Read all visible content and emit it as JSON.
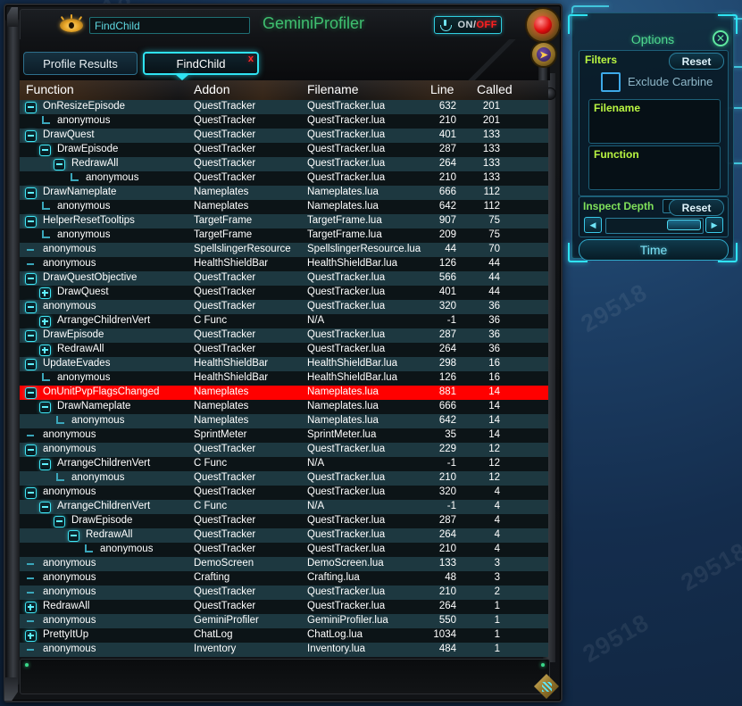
{
  "window": {
    "app_title": "GeminiProfiler",
    "name_field_value": "FindChild",
    "toggle": {
      "on_label": "ON",
      "separator": "/",
      "off_label": "OFF"
    },
    "logo_icon": "eye-icon"
  },
  "tabs": [
    {
      "label": "Profile Results",
      "active": false
    },
    {
      "label": "FindChild",
      "active": true,
      "close_icon": "x"
    }
  ],
  "table": {
    "columns": [
      "Function",
      "Addon",
      "Filename",
      "Line",
      "Called"
    ],
    "rows": [
      {
        "indent": 0,
        "node": "minus",
        "function": "OnResizeEpisode",
        "addon": "QuestTracker",
        "filename": "QuestTracker.lua",
        "line": "632",
        "called": "201",
        "selected": false
      },
      {
        "indent": 1,
        "node": "elbow",
        "function": "anonymous",
        "addon": "QuestTracker",
        "filename": "QuestTracker.lua",
        "line": "210",
        "called": "201",
        "selected": false
      },
      {
        "indent": 0,
        "node": "minus",
        "function": "DrawQuest",
        "addon": "QuestTracker",
        "filename": "QuestTracker.lua",
        "line": "401",
        "called": "133",
        "selected": false
      },
      {
        "indent": 1,
        "node": "minus",
        "function": "DrawEpisode",
        "addon": "QuestTracker",
        "filename": "QuestTracker.lua",
        "line": "287",
        "called": "133",
        "selected": false
      },
      {
        "indent": 2,
        "node": "minus",
        "function": "RedrawAll",
        "addon": "QuestTracker",
        "filename": "QuestTracker.lua",
        "line": "264",
        "called": "133",
        "selected": false
      },
      {
        "indent": 3,
        "node": "elbow",
        "function": "anonymous",
        "addon": "QuestTracker",
        "filename": "QuestTracker.lua",
        "line": "210",
        "called": "133",
        "selected": false
      },
      {
        "indent": 0,
        "node": "minus",
        "function": "DrawNameplate",
        "addon": "Nameplates",
        "filename": "Nameplates.lua",
        "line": "666",
        "called": "112",
        "selected": false
      },
      {
        "indent": 1,
        "node": "elbow",
        "function": "anonymous",
        "addon": "Nameplates",
        "filename": "Nameplates.lua",
        "line": "642",
        "called": "112",
        "selected": false
      },
      {
        "indent": 0,
        "node": "minus",
        "function": "HelperResetTooltips",
        "addon": "TargetFrame",
        "filename": "TargetFrame.lua",
        "line": "907",
        "called": "75",
        "selected": false
      },
      {
        "indent": 1,
        "node": "elbow",
        "function": "anonymous",
        "addon": "TargetFrame",
        "filename": "TargetFrame.lua",
        "line": "209",
        "called": "75",
        "selected": false
      },
      {
        "indent": 0,
        "node": "leaf",
        "function": "anonymous",
        "addon": "SpellslingerResource",
        "filename": "SpellslingerResource.lua",
        "line": "44",
        "called": "70",
        "selected": false
      },
      {
        "indent": 0,
        "node": "leaf",
        "function": "anonymous",
        "addon": "HealthShieldBar",
        "filename": "HealthShieldBar.lua",
        "line": "126",
        "called": "44",
        "selected": false
      },
      {
        "indent": 0,
        "node": "minus",
        "function": "DrawQuestObjective",
        "addon": "QuestTracker",
        "filename": "QuestTracker.lua",
        "line": "566",
        "called": "44",
        "selected": false
      },
      {
        "indent": 1,
        "node": "plus",
        "function": "DrawQuest",
        "addon": "QuestTracker",
        "filename": "QuestTracker.lua",
        "line": "401",
        "called": "44",
        "selected": false
      },
      {
        "indent": 0,
        "node": "minus",
        "function": "anonymous",
        "addon": "QuestTracker",
        "filename": "QuestTracker.lua",
        "line": "320",
        "called": "36",
        "selected": false
      },
      {
        "indent": 1,
        "node": "plus",
        "function": "ArrangeChildrenVert",
        "addon": "C Func",
        "filename": "N/A",
        "line": "-1",
        "called": "36",
        "selected": false
      },
      {
        "indent": 0,
        "node": "minus",
        "function": "DrawEpisode",
        "addon": "QuestTracker",
        "filename": "QuestTracker.lua",
        "line": "287",
        "called": "36",
        "selected": false
      },
      {
        "indent": 1,
        "node": "plus",
        "function": "RedrawAll",
        "addon": "QuestTracker",
        "filename": "QuestTracker.lua",
        "line": "264",
        "called": "36",
        "selected": false
      },
      {
        "indent": 0,
        "node": "minus",
        "function": "UpdateEvades",
        "addon": "HealthShieldBar",
        "filename": "HealthShieldBar.lua",
        "line": "298",
        "called": "16",
        "selected": false
      },
      {
        "indent": 1,
        "node": "elbow",
        "function": "anonymous",
        "addon": "HealthShieldBar",
        "filename": "HealthShieldBar.lua",
        "line": "126",
        "called": "16",
        "selected": false
      },
      {
        "indent": 0,
        "node": "minus",
        "function": "OnUnitPvpFlagsChanged",
        "addon": "Nameplates",
        "filename": "Nameplates.lua",
        "line": "881",
        "called": "14",
        "selected": true
      },
      {
        "indent": 1,
        "node": "minus",
        "function": "DrawNameplate",
        "addon": "Nameplates",
        "filename": "Nameplates.lua",
        "line": "666",
        "called": "14",
        "selected": false
      },
      {
        "indent": 2,
        "node": "elbow",
        "function": "anonymous",
        "addon": "Nameplates",
        "filename": "Nameplates.lua",
        "line": "642",
        "called": "14",
        "selected": false
      },
      {
        "indent": 0,
        "node": "leaf",
        "function": "anonymous",
        "addon": "SprintMeter",
        "filename": "SprintMeter.lua",
        "line": "35",
        "called": "14",
        "selected": false
      },
      {
        "indent": 0,
        "node": "minus",
        "function": "anonymous",
        "addon": "QuestTracker",
        "filename": "QuestTracker.lua",
        "line": "229",
        "called": "12",
        "selected": false
      },
      {
        "indent": 1,
        "node": "minus",
        "function": "ArrangeChildrenVert",
        "addon": "C Func",
        "filename": "N/A",
        "line": "-1",
        "called": "12",
        "selected": false
      },
      {
        "indent": 2,
        "node": "elbow",
        "function": "anonymous",
        "addon": "QuestTracker",
        "filename": "QuestTracker.lua",
        "line": "210",
        "called": "12",
        "selected": false
      },
      {
        "indent": 0,
        "node": "minus",
        "function": "anonymous",
        "addon": "QuestTracker",
        "filename": "QuestTracker.lua",
        "line": "320",
        "called": "4",
        "selected": false
      },
      {
        "indent": 1,
        "node": "minus",
        "function": "ArrangeChildrenVert",
        "addon": "C Func",
        "filename": "N/A",
        "line": "-1",
        "called": "4",
        "selected": false
      },
      {
        "indent": 2,
        "node": "minus",
        "function": "DrawEpisode",
        "addon": "QuestTracker",
        "filename": "QuestTracker.lua",
        "line": "287",
        "called": "4",
        "selected": false
      },
      {
        "indent": 3,
        "node": "minus",
        "function": "RedrawAll",
        "addon": "QuestTracker",
        "filename": "QuestTracker.lua",
        "line": "264",
        "called": "4",
        "selected": false
      },
      {
        "indent": 4,
        "node": "elbow",
        "function": "anonymous",
        "addon": "QuestTracker",
        "filename": "QuestTracker.lua",
        "line": "210",
        "called": "4",
        "selected": false
      },
      {
        "indent": 0,
        "node": "leaf",
        "function": "anonymous",
        "addon": "DemoScreen",
        "filename": "DemoScreen.lua",
        "line": "133",
        "called": "3",
        "selected": false
      },
      {
        "indent": 0,
        "node": "leaf",
        "function": "anonymous",
        "addon": "Crafting",
        "filename": "Crafting.lua",
        "line": "48",
        "called": "3",
        "selected": false
      },
      {
        "indent": 0,
        "node": "leaf",
        "function": "anonymous",
        "addon": "QuestTracker",
        "filename": "QuestTracker.lua",
        "line": "210",
        "called": "2",
        "selected": false
      },
      {
        "indent": 0,
        "node": "plus",
        "function": "RedrawAll",
        "addon": "QuestTracker",
        "filename": "QuestTracker.lua",
        "line": "264",
        "called": "1",
        "selected": false
      },
      {
        "indent": 0,
        "node": "leaf",
        "function": "anonymous",
        "addon": "GeminiProfiler",
        "filename": "GeminiProfiler.lua",
        "line": "550",
        "called": "1",
        "selected": false
      },
      {
        "indent": 0,
        "node": "plus",
        "function": "PrettyItUp",
        "addon": "ChatLog",
        "filename": "ChatLog.lua",
        "line": "1034",
        "called": "1",
        "selected": false
      },
      {
        "indent": 0,
        "node": "leaf",
        "function": "anonymous",
        "addon": "Inventory",
        "filename": "Inventory.lua",
        "line": "484",
        "called": "1",
        "selected": false
      }
    ]
  },
  "options": {
    "title": "Options",
    "close_icon": "close-icon",
    "filters_label": "Filters",
    "filters_reset_label": "Reset",
    "exclude_carbine_label": "Exclude Carbine",
    "exclude_carbine_checked": false,
    "filename_label": "Filename",
    "filename_value": "",
    "function_label": "Function",
    "function_value": "",
    "inspect_depth_label": "Inspect Depth",
    "inspect_depth_value": "5",
    "inspect_depth_reset_label": "Reset",
    "slider_left_icon": "◀",
    "slider_right_icon": "▶",
    "time_button_label": "Time"
  },
  "watermarks": [
    "29518",
    "29518",
    "29518",
    "29518",
    "29518",
    "29518"
  ],
  "colors": {
    "accent_cyan": "#2fe3f2",
    "accent_green": "#3fbf6f",
    "selected_row": "#ff0000",
    "row_odd": "#1d3840",
    "row_even": "#0c1417",
    "filter_label": "#b9f542"
  }
}
